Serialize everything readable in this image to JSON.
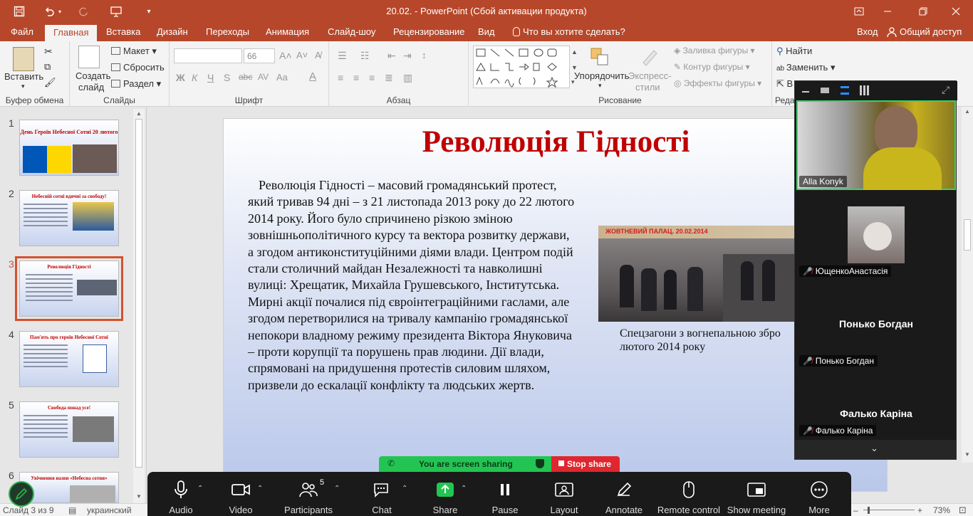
{
  "window": {
    "title": "20.02. - PowerPoint (Сбой активации продукта)"
  },
  "menu": {
    "tabs": [
      "Файл",
      "Главная",
      "Вставка",
      "Дизайн",
      "Переходы",
      "Анимация",
      "Слайд-шоу",
      "Рецензирование",
      "Вид"
    ],
    "search_placeholder": "Что вы хотите сделать?",
    "signin": "Вход",
    "share": "Общий доступ"
  },
  "ribbon": {
    "clipboard": {
      "paste": "Вставить",
      "group": "Буфер обмена"
    },
    "slides": {
      "new_slide_1": "Создать",
      "new_slide_2": "слайд",
      "layout": "Макет",
      "reset": "Сбросить",
      "section": "Раздел",
      "group": "Слайды"
    },
    "font": {
      "size": "66",
      "group": "Шрифт"
    },
    "paragraph": {
      "group": "Абзац"
    },
    "drawing": {
      "arrange": "Упорядочить",
      "styles_1": "Экспресс-",
      "styles_2": "стили",
      "fill": "Заливка фигуры",
      "outline": "Контур фигуры",
      "effects": "Эффекты фигуры",
      "group": "Рисование"
    },
    "editing": {
      "find": "Найти",
      "replace": "Заменить",
      "group": "Реда"
    }
  },
  "thumbnails": [
    {
      "num": "1",
      "title": "День Героїв Небесної Сотні 20 лютого"
    },
    {
      "num": "2",
      "title": "Небесній сотні вдячні за свободу!"
    },
    {
      "num": "3",
      "title": "Революція Гідності"
    },
    {
      "num": "4",
      "title": "Пам'ять про героїв Небесної Сотні"
    },
    {
      "num": "5",
      "title": "Свобода понад усе!"
    },
    {
      "num": "6",
      "title": "Увічнення назви «Небесна сотня»"
    }
  ],
  "slide": {
    "title": "Революція Гідності",
    "body": "Революція Гідності – масовий громадянський протест, який тривав 94 дні – з 21 листопада 2013 року до 22 лютого 2014 року. Його було спричинено різкою зміною зовнішньополітичного курсу та вектора розвитку держави, а згодом антиконституційними діями влади. Центром подій стали столичний майдан Незалежності та навколишні вулиці: Хрещатик, Михайла Грушевського, Інститутська. Мирні акції почалися під євроінтеграційними гаслами, але згодом перетворилися на тривалу кампанію громадянської непокори владному режиму президента Віктора Януковича – проти корупції та порушень прав людини. Дії влади, спрямовані на придушення протестів силовим шляхом, призвели до ескалації конфлікту та людських жертв.",
    "photo_caption": "Спецзагони з вогнепальною збро лютого 2014 року",
    "photo_stamp": "ЖОВТНЕВИЙ ПАЛАЦ. 20.02.2014"
  },
  "statusbar": {
    "slide_info": "Слайд 3 из 9",
    "language": "украинский",
    "zoom": "73%"
  },
  "zoom_panel": {
    "participants": [
      {
        "name": "Alla Konyk",
        "muted": false
      },
      {
        "name": "ЮщенкоАнастасія",
        "muted": true
      },
      {
        "name": "Понько Богдан",
        "muted": true
      },
      {
        "name": "Фалько Каріна",
        "muted": true
      }
    ]
  },
  "share_banner": {
    "status": "You are screen sharing",
    "stop": "Stop share"
  },
  "zoom_toolbar": {
    "participants_count": "5",
    "buttons": [
      "Audio",
      "Video",
      "Participants",
      "Chat",
      "Share",
      "Pause",
      "Layout",
      "Annotate",
      "Remote control",
      "Show meeting",
      "More"
    ]
  },
  "colors": {
    "accent": "#b7472a",
    "title_red": "#c00000",
    "zoom_green": "#2fb34a",
    "zoom_red": "#e0262e"
  }
}
